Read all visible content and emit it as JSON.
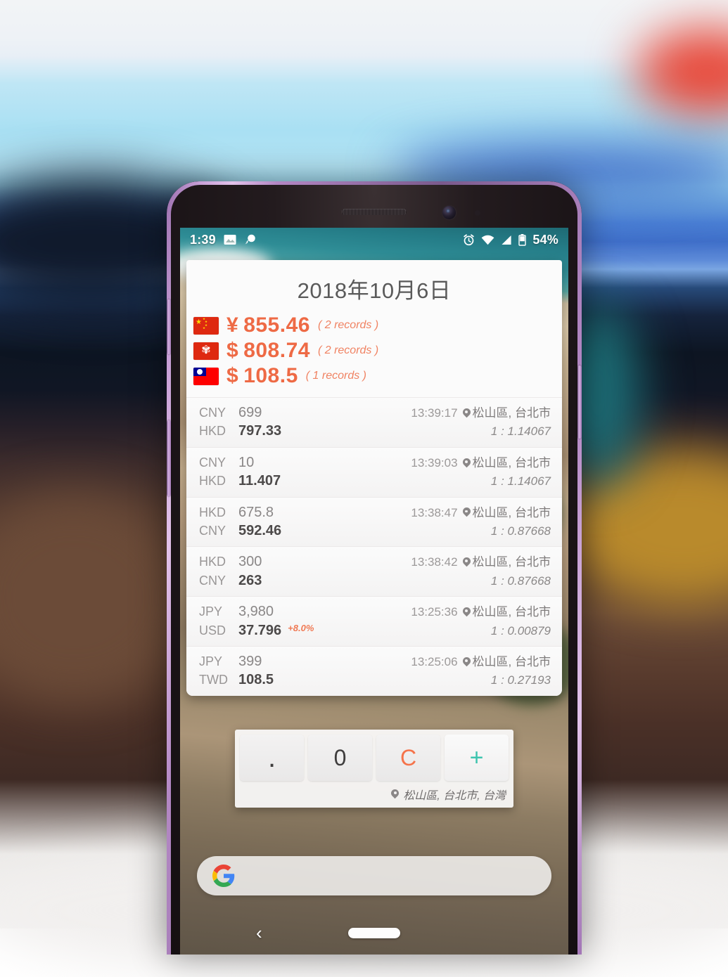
{
  "backdrop": {
    "description": "blurred-photo-backdrop"
  },
  "phone": {
    "status_bar": {
      "time": "1:39",
      "left_icons": [
        "image-icon",
        "message-bubble-icon"
      ],
      "right_icons": [
        "alarm-icon",
        "wifi-icon",
        "signal-icon",
        "battery-icon"
      ],
      "battery_percent": "54%"
    },
    "nav_bar": {
      "back_glyph": "‹",
      "home_pill": "home-pill"
    },
    "google_bar": {
      "logo": "google-g-logo",
      "placeholder": ""
    }
  },
  "app_card": {
    "title": "2018年10月6日",
    "summary": [
      {
        "flag": "cn",
        "symbol": "¥",
        "amount": "855.46",
        "records": "( 2 records )"
      },
      {
        "flag": "hk",
        "symbol": "$",
        "amount": "808.74",
        "records": "( 2 records )"
      },
      {
        "flag": "tw",
        "symbol": "$",
        "amount": "108.5",
        "records": "( 1 records )"
      }
    ],
    "transactions": [
      {
        "from_code": "CNY",
        "from_value": "699",
        "to_code": "HKD",
        "to_value": "797.33",
        "pct": "",
        "time": "13:39:17",
        "location": "松山區, 台北市",
        "rate": "1 : 1.14067"
      },
      {
        "from_code": "CNY",
        "from_value": "10",
        "to_code": "HKD",
        "to_value": "11.407",
        "pct": "",
        "time": "13:39:03",
        "location": "松山區, 台北市",
        "rate": "1 : 1.14067"
      },
      {
        "from_code": "HKD",
        "from_value": "675.8",
        "to_code": "CNY",
        "to_value": "592.46",
        "pct": "",
        "time": "13:38:47",
        "location": "松山區, 台北市",
        "rate": "1 : 0.87668"
      },
      {
        "from_code": "HKD",
        "from_value": "300",
        "to_code": "CNY",
        "to_value": "263",
        "pct": "",
        "time": "13:38:42",
        "location": "松山區, 台北市",
        "rate": "1 : 0.87668"
      },
      {
        "from_code": "JPY",
        "from_value": "3,980",
        "to_code": "USD",
        "to_value": "37.796",
        "pct": "+8.0%",
        "time": "13:25:36",
        "location": "松山區, 台北市",
        "rate": "1 : 0.00879"
      },
      {
        "from_code": "JPY",
        "from_value": "399",
        "to_code": "TWD",
        "to_value": "108.5",
        "pct": "",
        "time": "13:25:06",
        "location": "松山區, 台北市",
        "rate": "1 : 0.27193"
      }
    ]
  },
  "keypad": {
    "keys": [
      {
        "label": ".",
        "kind": "dot"
      },
      {
        "label": "0",
        "kind": "digit"
      },
      {
        "label": "C",
        "kind": "clear"
      },
      {
        "label": "+",
        "kind": "plus"
      }
    ],
    "footer_location": "松山區, 台北市, 台灣"
  },
  "colors": {
    "accent_orange": "#ee6a45",
    "clear_orange": "#f5734a",
    "plus_teal": "#3dc4ae",
    "title_gray": "#5a5a5a",
    "pct_orange": "#f07a55"
  }
}
